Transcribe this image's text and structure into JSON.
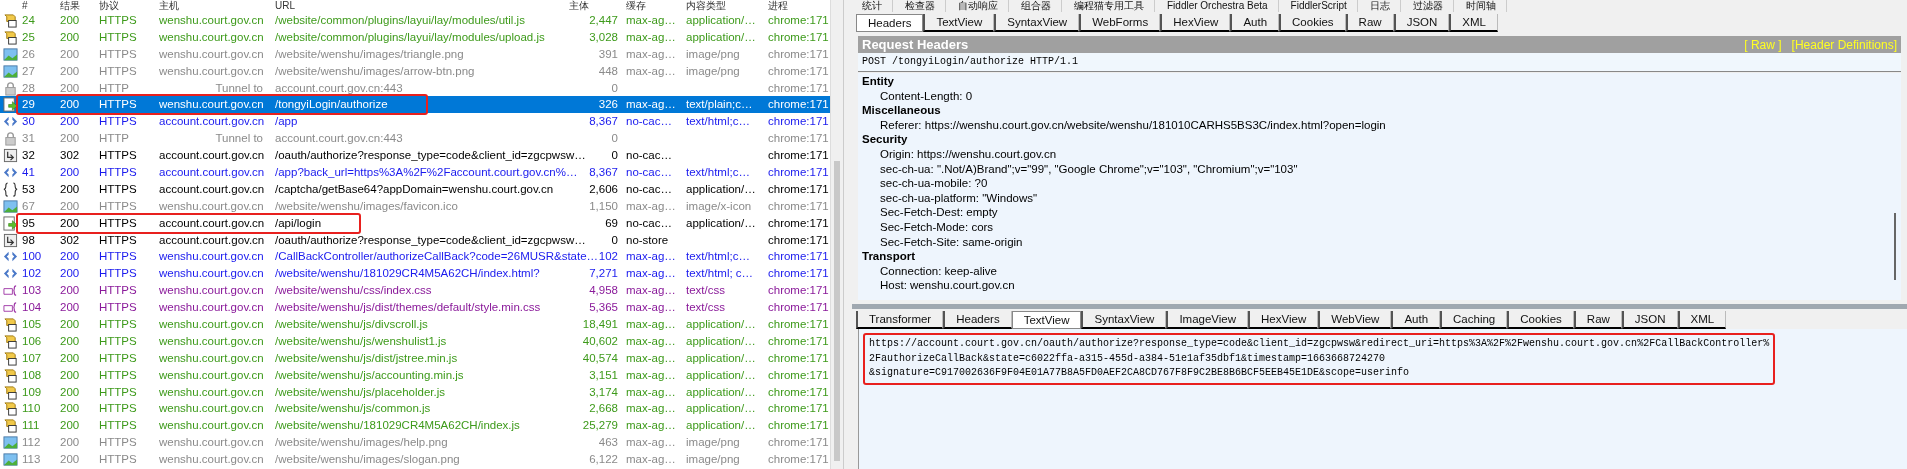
{
  "session_list": {
    "columns": [
      "#",
      "结果",
      "协议",
      "主机",
      "URL",
      "主体",
      "缓存",
      "内容类型",
      "进程"
    ],
    "rows": [
      {
        "kind": "script",
        "num": "24",
        "result": "200",
        "protocol": "HTTPS",
        "host": "wenshu.court.gov.cn",
        "url": "/website/common/plugins/layui/lay/modules/util.js",
        "body": "2,447",
        "caching": "max-ag…",
        "content_type": "application/…",
        "process": "chrome:171",
        "selected": false,
        "highlighted": false
      },
      {
        "kind": "script",
        "num": "25",
        "result": "200",
        "protocol": "HTTPS",
        "host": "wenshu.court.gov.cn",
        "url": "/website/common/plugins/layui/lay/modules/upload.js",
        "body": "3,028",
        "caching": "max-ag…",
        "content_type": "application/…",
        "process": "chrome:171",
        "selected": false,
        "highlighted": false
      },
      {
        "kind": "image",
        "num": "26",
        "result": "200",
        "protocol": "HTTPS",
        "host": "wenshu.court.gov.cn",
        "url": "/website/wenshu/images/triangle.png",
        "body": "391",
        "caching": "max-ag…",
        "content_type": "image/png",
        "process": "chrome:171",
        "selected": false,
        "highlighted": false
      },
      {
        "kind": "image",
        "num": "27",
        "result": "200",
        "protocol": "HTTPS",
        "host": "wenshu.court.gov.cn",
        "url": "/website/wenshu/images/arrow-btn.png",
        "body": "448",
        "caching": "max-ag…",
        "content_type": "image/png",
        "process": "chrome:171",
        "selected": false,
        "highlighted": false
      },
      {
        "kind": "tunnel",
        "num": "28",
        "result": "200",
        "protocol": "HTTP",
        "host": "Tunnel to",
        "url": "account.court.gov.cn:443",
        "body": "0",
        "process": "chrome:171",
        "selected": false,
        "highlighted": false
      },
      {
        "kind": "post",
        "num": "29",
        "result": "200",
        "protocol": "HTTPS",
        "host": "wenshu.court.gov.cn",
        "url": "/tongyiLogin/authorize",
        "body": "326",
        "caching": "max-ag…",
        "content_type": "text/plain;c…",
        "process": "chrome:171",
        "selected": true,
        "highlighted": true
      },
      {
        "kind": "html",
        "num": "30",
        "result": "200",
        "protocol": "HTTPS",
        "host": "account.court.gov.cn",
        "url": "/app",
        "body": "8,367",
        "caching": "no-cac…",
        "content_type": "text/html;c…",
        "process": "chrome:171",
        "selected": false,
        "highlighted": false
      },
      {
        "kind": "tunnel",
        "num": "31",
        "result": "200",
        "protocol": "HTTP",
        "host": "Tunnel to",
        "url": "account.court.gov.cn:443",
        "body": "0",
        "process": "chrome:171",
        "selected": false,
        "highlighted": false
      },
      {
        "kind": "redirect",
        "num": "32",
        "result": "302",
        "protocol": "HTTPS",
        "host": "account.court.gov.cn",
        "url": "/oauth/authorize?response_type=code&client_id=zgcpwsw…",
        "body": "0",
        "caching": "no-cac…",
        "process": "chrome:171",
        "selected": false,
        "highlighted": false
      },
      {
        "kind": "html",
        "num": "41",
        "result": "200",
        "protocol": "HTTPS",
        "host": "account.court.gov.cn",
        "url": "/app?back_url=https%3A%2F%2Faccount.court.gov.cn%…",
        "body": "8,367",
        "caching": "no-cac…",
        "content_type": "text/html;c…",
        "process": "chrome:171",
        "selected": false,
        "highlighted": false
      },
      {
        "kind": "json",
        "num": "53",
        "result": "200",
        "protocol": "HTTPS",
        "host": "account.court.gov.cn",
        "url": "/captcha/getBase64?appDomain=wenshu.court.gov.cn",
        "body": "2,606",
        "caching": "no-cac…",
        "content_type": "application/…",
        "process": "chrome:171",
        "selected": false,
        "highlighted": false
      },
      {
        "kind": "image",
        "num": "67",
        "result": "200",
        "protocol": "HTTPS",
        "host": "wenshu.court.gov.cn",
        "url": "/website/wenshu/images/favicon.ico",
        "body": "1,150",
        "caching": "max-ag…",
        "content_type": "image/x-icon",
        "process": "chrome:171",
        "selected": false,
        "highlighted": false
      },
      {
        "kind": "post",
        "num": "95",
        "result": "200",
        "protocol": "HTTPS",
        "host": "account.court.gov.cn",
        "url": "/api/login",
        "body": "69",
        "caching": "no-cac…",
        "content_type": "application/…",
        "process": "chrome:171",
        "selected": false,
        "highlighted": true
      },
      {
        "kind": "redirect",
        "num": "98",
        "result": "302",
        "protocol": "HTTPS",
        "host": "account.court.gov.cn",
        "url": "/oauth/authorize?response_type=code&client_id=zgcpwsw…",
        "body": "0",
        "caching": "no-store",
        "process": "chrome:171",
        "selected": false,
        "highlighted": false
      },
      {
        "kind": "html",
        "num": "100",
        "result": "200",
        "protocol": "HTTPS",
        "host": "wenshu.court.gov.cn",
        "url": "/CallBackController/authorizeCallBack?code=26MUSR&state…",
        "body": "102",
        "caching": "max-ag…",
        "content_type": "text/html;c…",
        "process": "chrome:171",
        "selected": false,
        "highlighted": false
      },
      {
        "kind": "html",
        "num": "102",
        "result": "200",
        "protocol": "HTTPS",
        "host": "wenshu.court.gov.cn",
        "url": "/website/wenshu/181029CR4M5A62CH/index.html?",
        "body": "7,271",
        "caching": "max-ag…",
        "content_type": "text/html; c…",
        "process": "chrome:171",
        "selected": false,
        "highlighted": false
      },
      {
        "kind": "css",
        "num": "103",
        "result": "200",
        "protocol": "HTTPS",
        "host": "wenshu.court.gov.cn",
        "url": "/website/wenshu/css/index.css",
        "body": "4,958",
        "caching": "max-ag…",
        "content_type": "text/css",
        "process": "chrome:171",
        "selected": false,
        "highlighted": false
      },
      {
        "kind": "css",
        "num": "104",
        "result": "200",
        "protocol": "HTTPS",
        "host": "wenshu.court.gov.cn",
        "url": "/website/wenshu/js/dist/themes/default/style.min.css",
        "body": "5,365",
        "caching": "max-ag…",
        "content_type": "text/css",
        "process": "chrome:171",
        "selected": false,
        "highlighted": false
      },
      {
        "kind": "script",
        "num": "105",
        "result": "200",
        "protocol": "HTTPS",
        "host": "wenshu.court.gov.cn",
        "url": "/website/wenshu/js/divscroll.js",
        "body": "18,491",
        "caching": "max-ag…",
        "content_type": "application/…",
        "process": "chrome:171",
        "selected": false,
        "highlighted": false
      },
      {
        "kind": "script",
        "num": "106",
        "result": "200",
        "protocol": "HTTPS",
        "host": "wenshu.court.gov.cn",
        "url": "/website/wenshu/js/wenshulist1.js",
        "body": "40,602",
        "caching": "max-ag…",
        "content_type": "application/…",
        "process": "chrome:171",
        "selected": false,
        "highlighted": false
      },
      {
        "kind": "script",
        "num": "107",
        "result": "200",
        "protocol": "HTTPS",
        "host": "wenshu.court.gov.cn",
        "url": "/website/wenshu/js/dist/jstree.min.js",
        "body": "40,574",
        "caching": "max-ag…",
        "content_type": "application/…",
        "process": "chrome:171",
        "selected": false,
        "highlighted": false
      },
      {
        "kind": "script",
        "num": "108",
        "result": "200",
        "protocol": "HTTPS",
        "host": "wenshu.court.gov.cn",
        "url": "/website/wenshu/js/accounting.min.js",
        "body": "3,151",
        "caching": "max-ag…",
        "content_type": "application/…",
        "process": "chrome:171",
        "selected": false,
        "highlighted": false
      },
      {
        "kind": "script",
        "num": "109",
        "result": "200",
        "protocol": "HTTPS",
        "host": "wenshu.court.gov.cn",
        "url": "/website/wenshu/js/placeholder.js",
        "body": "3,174",
        "caching": "max-ag…",
        "content_type": "application/…",
        "process": "chrome:171",
        "selected": false,
        "highlighted": false
      },
      {
        "kind": "script",
        "num": "110",
        "result": "200",
        "protocol": "HTTPS",
        "host": "wenshu.court.gov.cn",
        "url": "/website/wenshu/js/common.js",
        "body": "2,668",
        "caching": "max-ag…",
        "content_type": "application/…",
        "process": "chrome:171",
        "selected": false,
        "highlighted": false
      },
      {
        "kind": "script",
        "num": "111",
        "result": "200",
        "protocol": "HTTPS",
        "host": "wenshu.court.gov.cn",
        "url": "/website/wenshu/181029CR4M5A62CH/index.js",
        "body": "25,279",
        "caching": "max-ag…",
        "content_type": "application/…",
        "process": "chrome:171",
        "selected": false,
        "highlighted": false
      },
      {
        "kind": "image",
        "num": "112",
        "result": "200",
        "protocol": "HTTPS",
        "host": "wenshu.court.gov.cn",
        "url": "/website/wenshu/images/help.png",
        "body": "463",
        "caching": "max-ag…",
        "content_type": "image/png",
        "process": "chrome:171",
        "selected": false,
        "highlighted": false
      },
      {
        "kind": "image",
        "num": "113",
        "result": "200",
        "protocol": "HTTPS",
        "host": "wenshu.court.gov.cn",
        "url": "/website/wenshu/images/slogan.png",
        "body": "6,122",
        "caching": "max-ag…",
        "content_type": "image/png",
        "process": "chrome:171",
        "selected": false,
        "highlighted": false
      }
    ]
  },
  "toolbar": [
    "统计",
    "检查器",
    "自动响应",
    "组合器",
    "编程猫专用工具",
    "Fiddler Orchestra Beta",
    "FiddlerScript",
    "日志",
    "过滤器",
    "时间轴"
  ],
  "request_tabs": [
    {
      "label": "Headers",
      "selected": true
    },
    {
      "label": "TextView",
      "selected": false
    },
    {
      "label": "SyntaxView",
      "selected": false
    },
    {
      "label": "WebForms",
      "selected": false
    },
    {
      "label": "HexView",
      "selected": false
    },
    {
      "label": "Auth",
      "selected": false
    },
    {
      "label": "Cookies",
      "selected": false
    },
    {
      "label": "Raw",
      "selected": false
    },
    {
      "label": "JSON",
      "selected": false
    },
    {
      "label": "XML",
      "selected": false
    }
  ],
  "request_headers": {
    "title": "Request Headers",
    "links": [
      "[ Raw ]",
      "[Header Definitions]"
    ],
    "request_line": "POST /tongyiLogin/authorize HTTP/1.1",
    "groups": [
      {
        "name": "Entity",
        "headers": [
          "Content-Length: 0"
        ]
      },
      {
        "name": "Miscellaneous",
        "headers": [
          "Referer: https://wenshu.court.gov.cn/website/wenshu/181010CARHS5BS3C/index.html?open=login"
        ]
      },
      {
        "name": "Security",
        "headers": [
          "Origin: https://wenshu.court.gov.cn",
          "sec-ch-ua: \".Not/A)Brand\";v=\"99\", \"Google Chrome\";v=\"103\", \"Chromium\";v=\"103\"",
          "sec-ch-ua-mobile: ?0",
          "sec-ch-ua-platform: \"Windows\"",
          "Sec-Fetch-Dest: empty",
          "Sec-Fetch-Mode: cors",
          "Sec-Fetch-Site: same-origin"
        ]
      },
      {
        "name": "Transport",
        "headers": [
          "Connection: keep-alive",
          "Host: wenshu.court.gov.cn"
        ]
      }
    ]
  },
  "response_tabs": [
    {
      "label": "Transformer",
      "selected": false
    },
    {
      "label": "Headers",
      "selected": false
    },
    {
      "label": "TextView",
      "selected": true
    },
    {
      "label": "SyntaxView",
      "selected": false
    },
    {
      "label": "ImageView",
      "selected": false
    },
    {
      "label": "HexView",
      "selected": false
    },
    {
      "label": "WebView",
      "selected": false
    },
    {
      "label": "Auth",
      "selected": false
    },
    {
      "label": "Caching",
      "selected": false
    },
    {
      "label": "Cookies",
      "selected": false
    },
    {
      "label": "Raw",
      "selected": false
    },
    {
      "label": "JSON",
      "selected": false
    },
    {
      "label": "XML",
      "selected": false
    }
  ],
  "response_text": {
    "highlighted": true,
    "lines": [
      "https://account.court.gov.cn/oauth/authorize?response_type=code&client_id=zgcpwsw&redirect_uri=https%3A%2F%2Fwenshu.court.gov.cn%2FCallBackController%",
      "2FauthorizeCallBack&state=c6022ffa-a315-455d-a384-51e1af35dbf1&timestamp=1663668724270",
      "&signature=C917002636F9F04E01A77B8A5FD0AEF2CA8CD767F8F9C2BE8B6BCF5EEB45E1DE&scope=userinfo"
    ]
  }
}
